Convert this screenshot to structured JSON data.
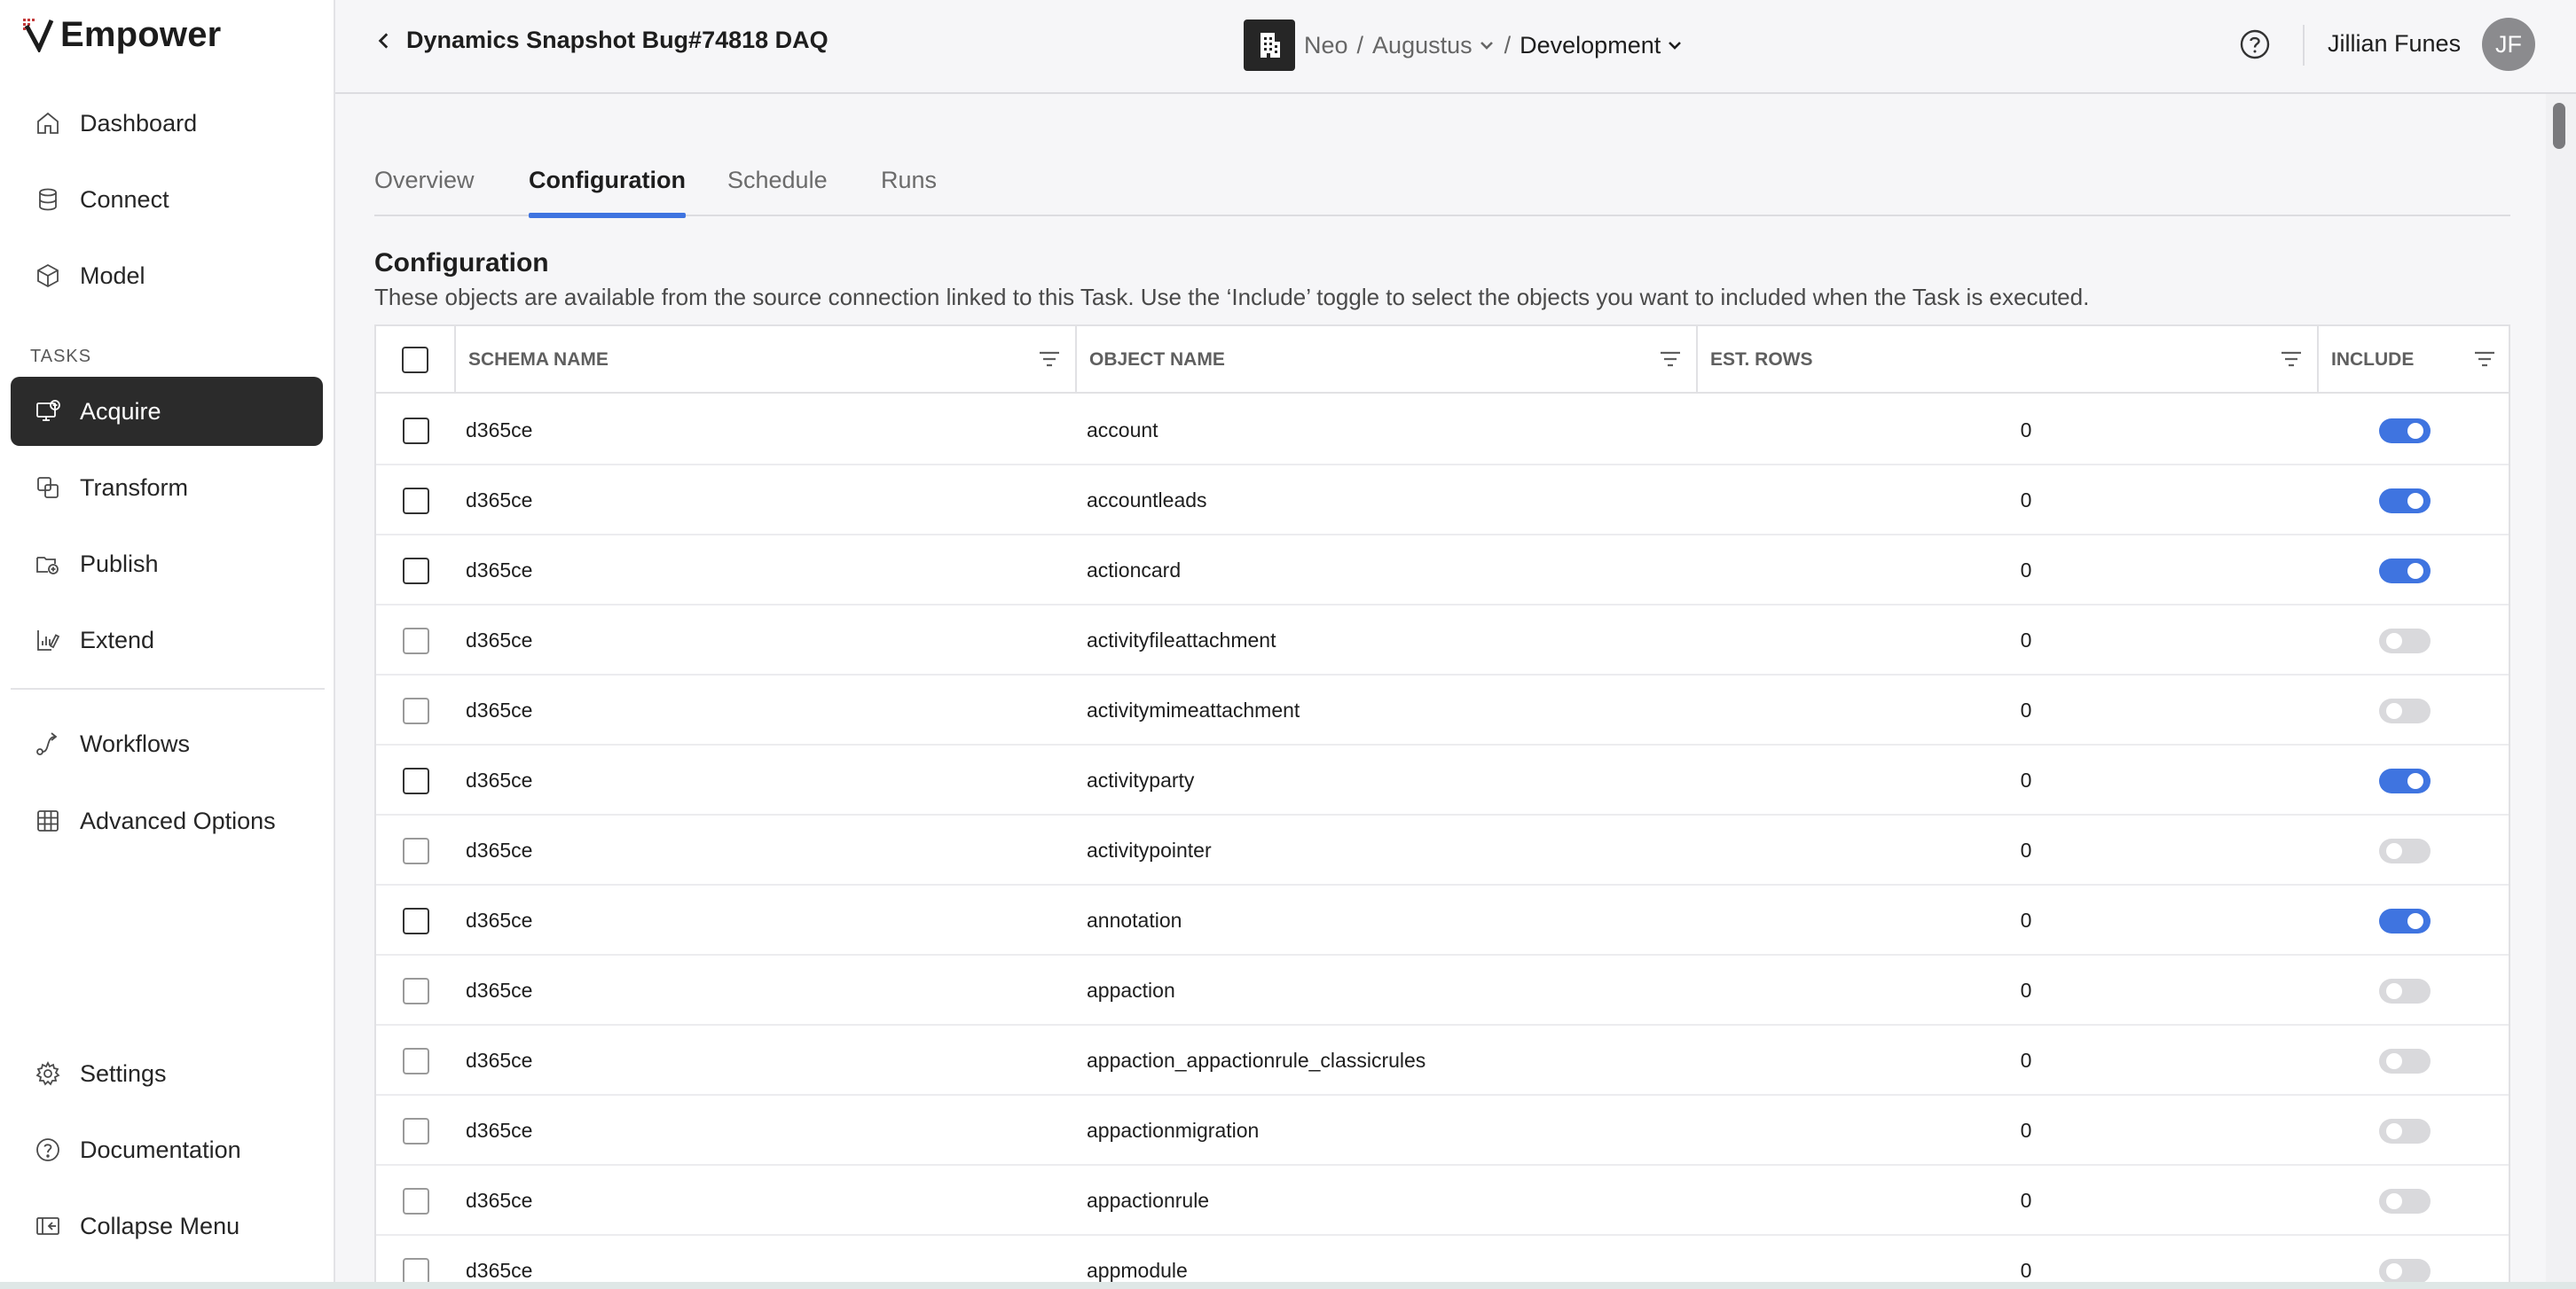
{
  "brand": {
    "name": "Empower"
  },
  "sidebar": {
    "top_items": [
      {
        "label": "Dashboard",
        "icon": "home-icon"
      },
      {
        "label": "Connect",
        "icon": "database-icon"
      },
      {
        "label": "Model",
        "icon": "cube-icon"
      }
    ],
    "section_label": "TASKS",
    "task_items": [
      {
        "label": "Acquire",
        "icon": "acquire-icon",
        "active": true
      },
      {
        "label": "Transform",
        "icon": "transform-icon"
      },
      {
        "label": "Publish",
        "icon": "publish-icon"
      },
      {
        "label": "Extend",
        "icon": "extend-icon"
      }
    ],
    "extra_items": [
      {
        "label": "Workflows",
        "icon": "workflow-icon"
      },
      {
        "label": "Advanced Options",
        "icon": "grid-icon"
      }
    ],
    "bottom_items": [
      {
        "label": "Settings",
        "icon": "gear-icon"
      },
      {
        "label": "Documentation",
        "icon": "help-circle-icon"
      },
      {
        "label": "Collapse Menu",
        "icon": "collapse-icon"
      }
    ]
  },
  "header": {
    "back_title": "Dynamics Snapshot Bug#74818 DAQ",
    "org": "Neo",
    "project": "Augustus",
    "environment": "Development",
    "separator": "/",
    "user_name": "Jillian Funes",
    "user_initials": "JF"
  },
  "tabs": [
    {
      "label": "Overview",
      "active": false
    },
    {
      "label": "Configuration",
      "active": true
    },
    {
      "label": "Schedule",
      "active": false
    },
    {
      "label": "Runs",
      "active": false
    }
  ],
  "configuration": {
    "title": "Configuration",
    "description": "These objects are available from the source connection linked to this Task. Use the ‘Include’ toggle to select the objects you want to included when the Task is executed."
  },
  "table": {
    "columns": [
      "SCHEMA NAME",
      "OBJECT NAME",
      "EST. ROWS",
      "INCLUDE"
    ],
    "rows": [
      {
        "schema": "d365ce",
        "object": "account",
        "rows": "0",
        "include": true
      },
      {
        "schema": "d365ce",
        "object": "accountleads",
        "rows": "0",
        "include": true
      },
      {
        "schema": "d365ce",
        "object": "actioncard",
        "rows": "0",
        "include": true
      },
      {
        "schema": "d365ce",
        "object": "activityfileattachment",
        "rows": "0",
        "include": false
      },
      {
        "schema": "d365ce",
        "object": "activitymimeattachment",
        "rows": "0",
        "include": false
      },
      {
        "schema": "d365ce",
        "object": "activityparty",
        "rows": "0",
        "include": true
      },
      {
        "schema": "d365ce",
        "object": "activitypointer",
        "rows": "0",
        "include": false
      },
      {
        "schema": "d365ce",
        "object": "annotation",
        "rows": "0",
        "include": true
      },
      {
        "schema": "d365ce",
        "object": "appaction",
        "rows": "0",
        "include": false
      },
      {
        "schema": "d365ce",
        "object": "appaction_appactionrule_classicrules",
        "rows": "0",
        "include": false
      },
      {
        "schema": "d365ce",
        "object": "appactionmigration",
        "rows": "0",
        "include": false
      },
      {
        "schema": "d365ce",
        "object": "appactionrule",
        "rows": "0",
        "include": false
      },
      {
        "schema": "d365ce",
        "object": "appmodule",
        "rows": "0",
        "include": false
      }
    ]
  },
  "colors": {
    "accent": "#3f74e0",
    "active_nav": "#2b2b2b"
  }
}
